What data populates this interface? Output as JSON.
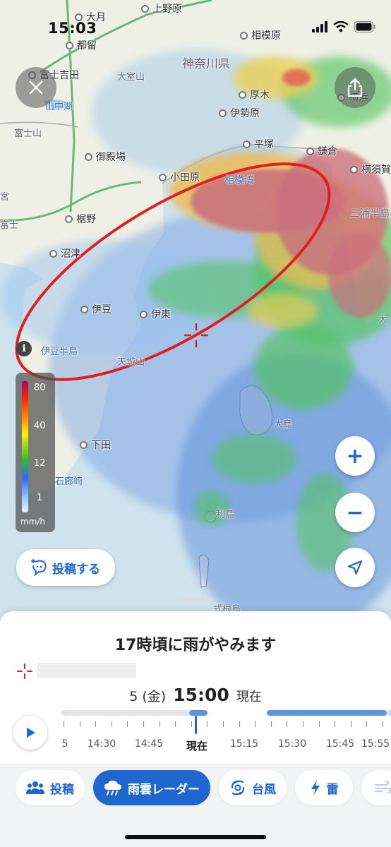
{
  "status": {
    "time": "15:03"
  },
  "map": {
    "places": [
      {
        "id": "omachi",
        "name": "大月"
      },
      {
        "id": "kamino",
        "name": "上野原"
      },
      {
        "id": "tsuru",
        "name": "都留"
      },
      {
        "id": "sagamihara",
        "name": "相模原"
      },
      {
        "id": "fujiyoshida",
        "name": "富士吉田"
      },
      {
        "id": "atsugi",
        "name": "厚木"
      },
      {
        "id": "isehara",
        "name": "伊勢原"
      },
      {
        "id": "yokohama",
        "name": "横浜"
      },
      {
        "id": "gotemba",
        "name": "御殿場"
      },
      {
        "id": "hiratsuka",
        "name": "平塚"
      },
      {
        "id": "kamakura",
        "name": "鎌倉"
      },
      {
        "id": "yokosuka",
        "name": "横須賀"
      },
      {
        "id": "odawara",
        "name": "小田原"
      },
      {
        "id": "susono",
        "name": "裾野"
      },
      {
        "id": "numazu",
        "name": "沼津"
      },
      {
        "id": "izu",
        "name": "伊豆"
      },
      {
        "id": "ito",
        "name": "伊東"
      },
      {
        "id": "shimoda",
        "name": "下田"
      }
    ],
    "regions": [
      {
        "id": "kanagawa",
        "name": "神奈川県"
      },
      {
        "id": "omuroyama",
        "name": "大室山"
      },
      {
        "id": "yamanakako",
        "name": "山中湖"
      },
      {
        "id": "fujisan",
        "name": "富士山"
      },
      {
        "id": "sagamiwan",
        "name": "相模湾"
      },
      {
        "id": "miura",
        "name": "三浦半島"
      },
      {
        "id": "izuhanto",
        "name": "伊豆半島"
      },
      {
        "id": "amagi",
        "name": "天城山"
      },
      {
        "id": "oshima",
        "name": "大島"
      },
      {
        "id": "toshima",
        "name": "利島"
      },
      {
        "id": "irozaki",
        "name": "石廊崎"
      },
      {
        "id": "shikine",
        "name": "式根島"
      },
      {
        "id": "fuji_cut",
        "name": "富士"
      },
      {
        "id": "miya_cut",
        "name": "宮"
      },
      {
        "id": "dai_cut",
        "name": "大"
      }
    ],
    "legend": {
      "levels": [
        "80",
        "40",
        "12",
        "1"
      ],
      "unit": "mm/h"
    },
    "post_button": "投稿する",
    "zoom_in": "+",
    "zoom_out": "−"
  },
  "sheet": {
    "headline": "17時頃に雨がやみます",
    "date": "5 (金)",
    "time": "15:00",
    "now_label": "現在",
    "timeline_labels": [
      "5",
      "14:30",
      "14:45",
      "現在",
      "15:15",
      "15:30",
      "15:45",
      "15:55"
    ]
  },
  "tabs": [
    {
      "id": "post",
      "label": "投稿"
    },
    {
      "id": "radar",
      "label": "雨雲レーダー"
    },
    {
      "id": "typhoon",
      "label": "台風"
    },
    {
      "id": "thunder",
      "label": "雷"
    }
  ],
  "colors": {
    "accent": "#1f66d1",
    "annotation": "#e02020"
  }
}
